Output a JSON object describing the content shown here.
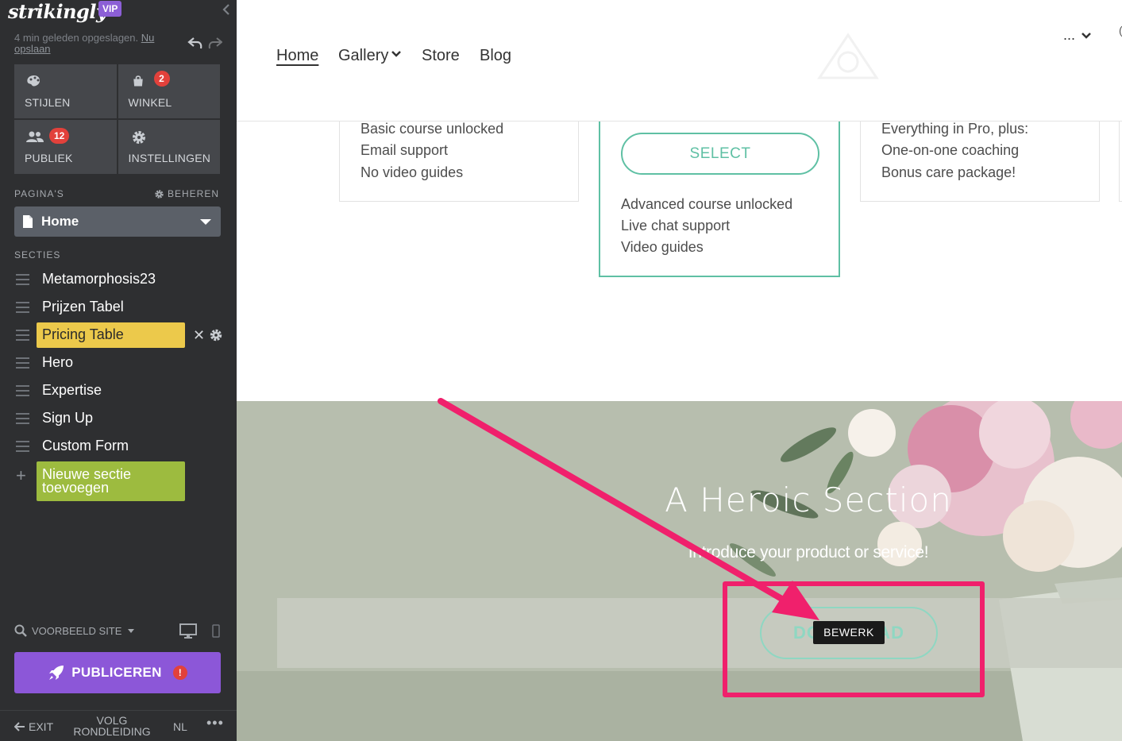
{
  "sidebar": {
    "logo": "strikingly",
    "vip": "VIP",
    "saved_text": "4 min geleden opgeslagen.",
    "save_now": "Nu opslaan",
    "tiles": [
      {
        "label": "STIJLEN",
        "icon": "palette-icon",
        "badge": ""
      },
      {
        "label": "WINKEL",
        "icon": "shopping-bag-icon",
        "badge": "2"
      },
      {
        "label": "PUBLIEK",
        "icon": "people-icon",
        "badge": "12"
      },
      {
        "label": "INSTELLINGEN",
        "icon": "gear-icon",
        "badge": ""
      }
    ],
    "pages_label": "PAGINA'S",
    "manage_label": "BEHEREN",
    "current_page": "Home",
    "sections_label": "SECTIES",
    "sections": [
      "Metamorphosis23",
      "Prijzen Tabel",
      "Pricing Table",
      "Hero",
      "Expertise",
      "Sign Up",
      "Custom Form"
    ],
    "active_section": "Pricing Table",
    "add_section": "Nieuwe sectie toevoegen",
    "preview_label": "VOORBEELD SITE",
    "publish_label": "PUBLICEREN",
    "publish_alert": "!",
    "footer": {
      "exit": "EXIT",
      "tour": "VOLG RONDLEIDING",
      "lang": "NL",
      "more": "•••"
    }
  },
  "site": {
    "nav": [
      "Home",
      "Gallery",
      "Store",
      "Blog"
    ],
    "nav_more": "...",
    "nav_edge": "(",
    "pricing": {
      "left": [
        "Basic course unlocked",
        "Email support",
        "No video guides"
      ],
      "middle_button": "SELECT",
      "middle": [
        "Advanced course unlocked",
        "Live chat support",
        "Video guides"
      ],
      "right": [
        "Everything in Pro, plus:",
        "One-on-one coaching",
        "Bonus care package!"
      ]
    },
    "hero": {
      "title": "A Heroic Section",
      "subtitle": "Introduce your product or service!",
      "button": "DOWNLOAD",
      "edit_tooltip": "BEWERK"
    }
  },
  "colors": {
    "sidebar_bg": "#2e2f31",
    "active_section": "#ecc94b",
    "add_section": "#9dbb3f",
    "publish": "#8c57d8",
    "accent_teal": "#5fc0a4",
    "annotation": "#f0206c",
    "badge_red": "#e2413b"
  }
}
